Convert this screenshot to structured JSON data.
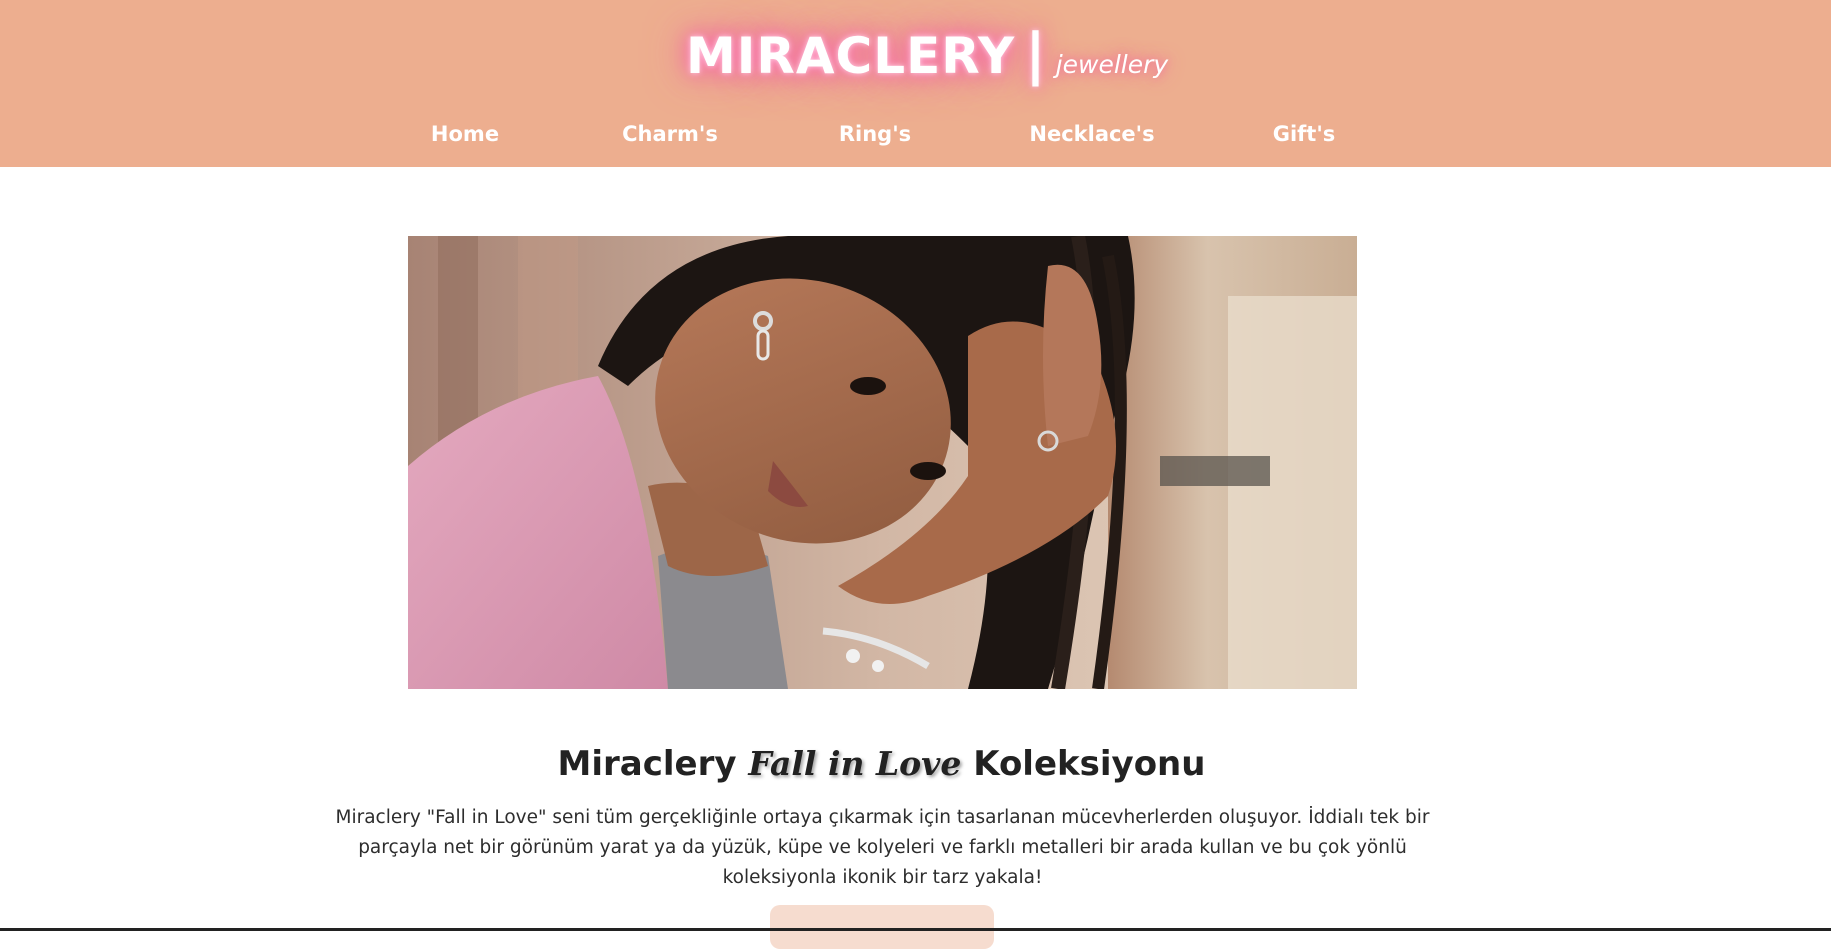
{
  "header": {
    "brand_name": "MIRACLERY",
    "brand_separator": "|",
    "brand_tagline": "jewellery",
    "background_color": "#edae8f"
  },
  "nav": {
    "items": [
      {
        "label": "Home"
      },
      {
        "label": "Charm's"
      },
      {
        "label": "Ring's"
      },
      {
        "label": "Necklace's"
      },
      {
        "label": "Gift's"
      }
    ]
  },
  "hero": {
    "image_subject": "model-with-jewellery-photo"
  },
  "collection": {
    "title_prefix": "Miraclery",
    "title_italic": "Fall in Love",
    "title_suffix": "Koleksiyonu",
    "description": "Miraclery \"Fall in Love\" seni tüm gerçekliğinle ortaya çıkarmak için tasarlanan mücevherlerden oluşuyor. İddialı tek bir parçayla net bir görünüm yarat ya da yüzük, küpe ve kolyeleri ve farklı metalleri bir arada kullan ve bu çok yönlü koleksiyonla ikonik bir tarz yakala!",
    "cta_label": "",
    "cta_color": "#f6dccf"
  }
}
